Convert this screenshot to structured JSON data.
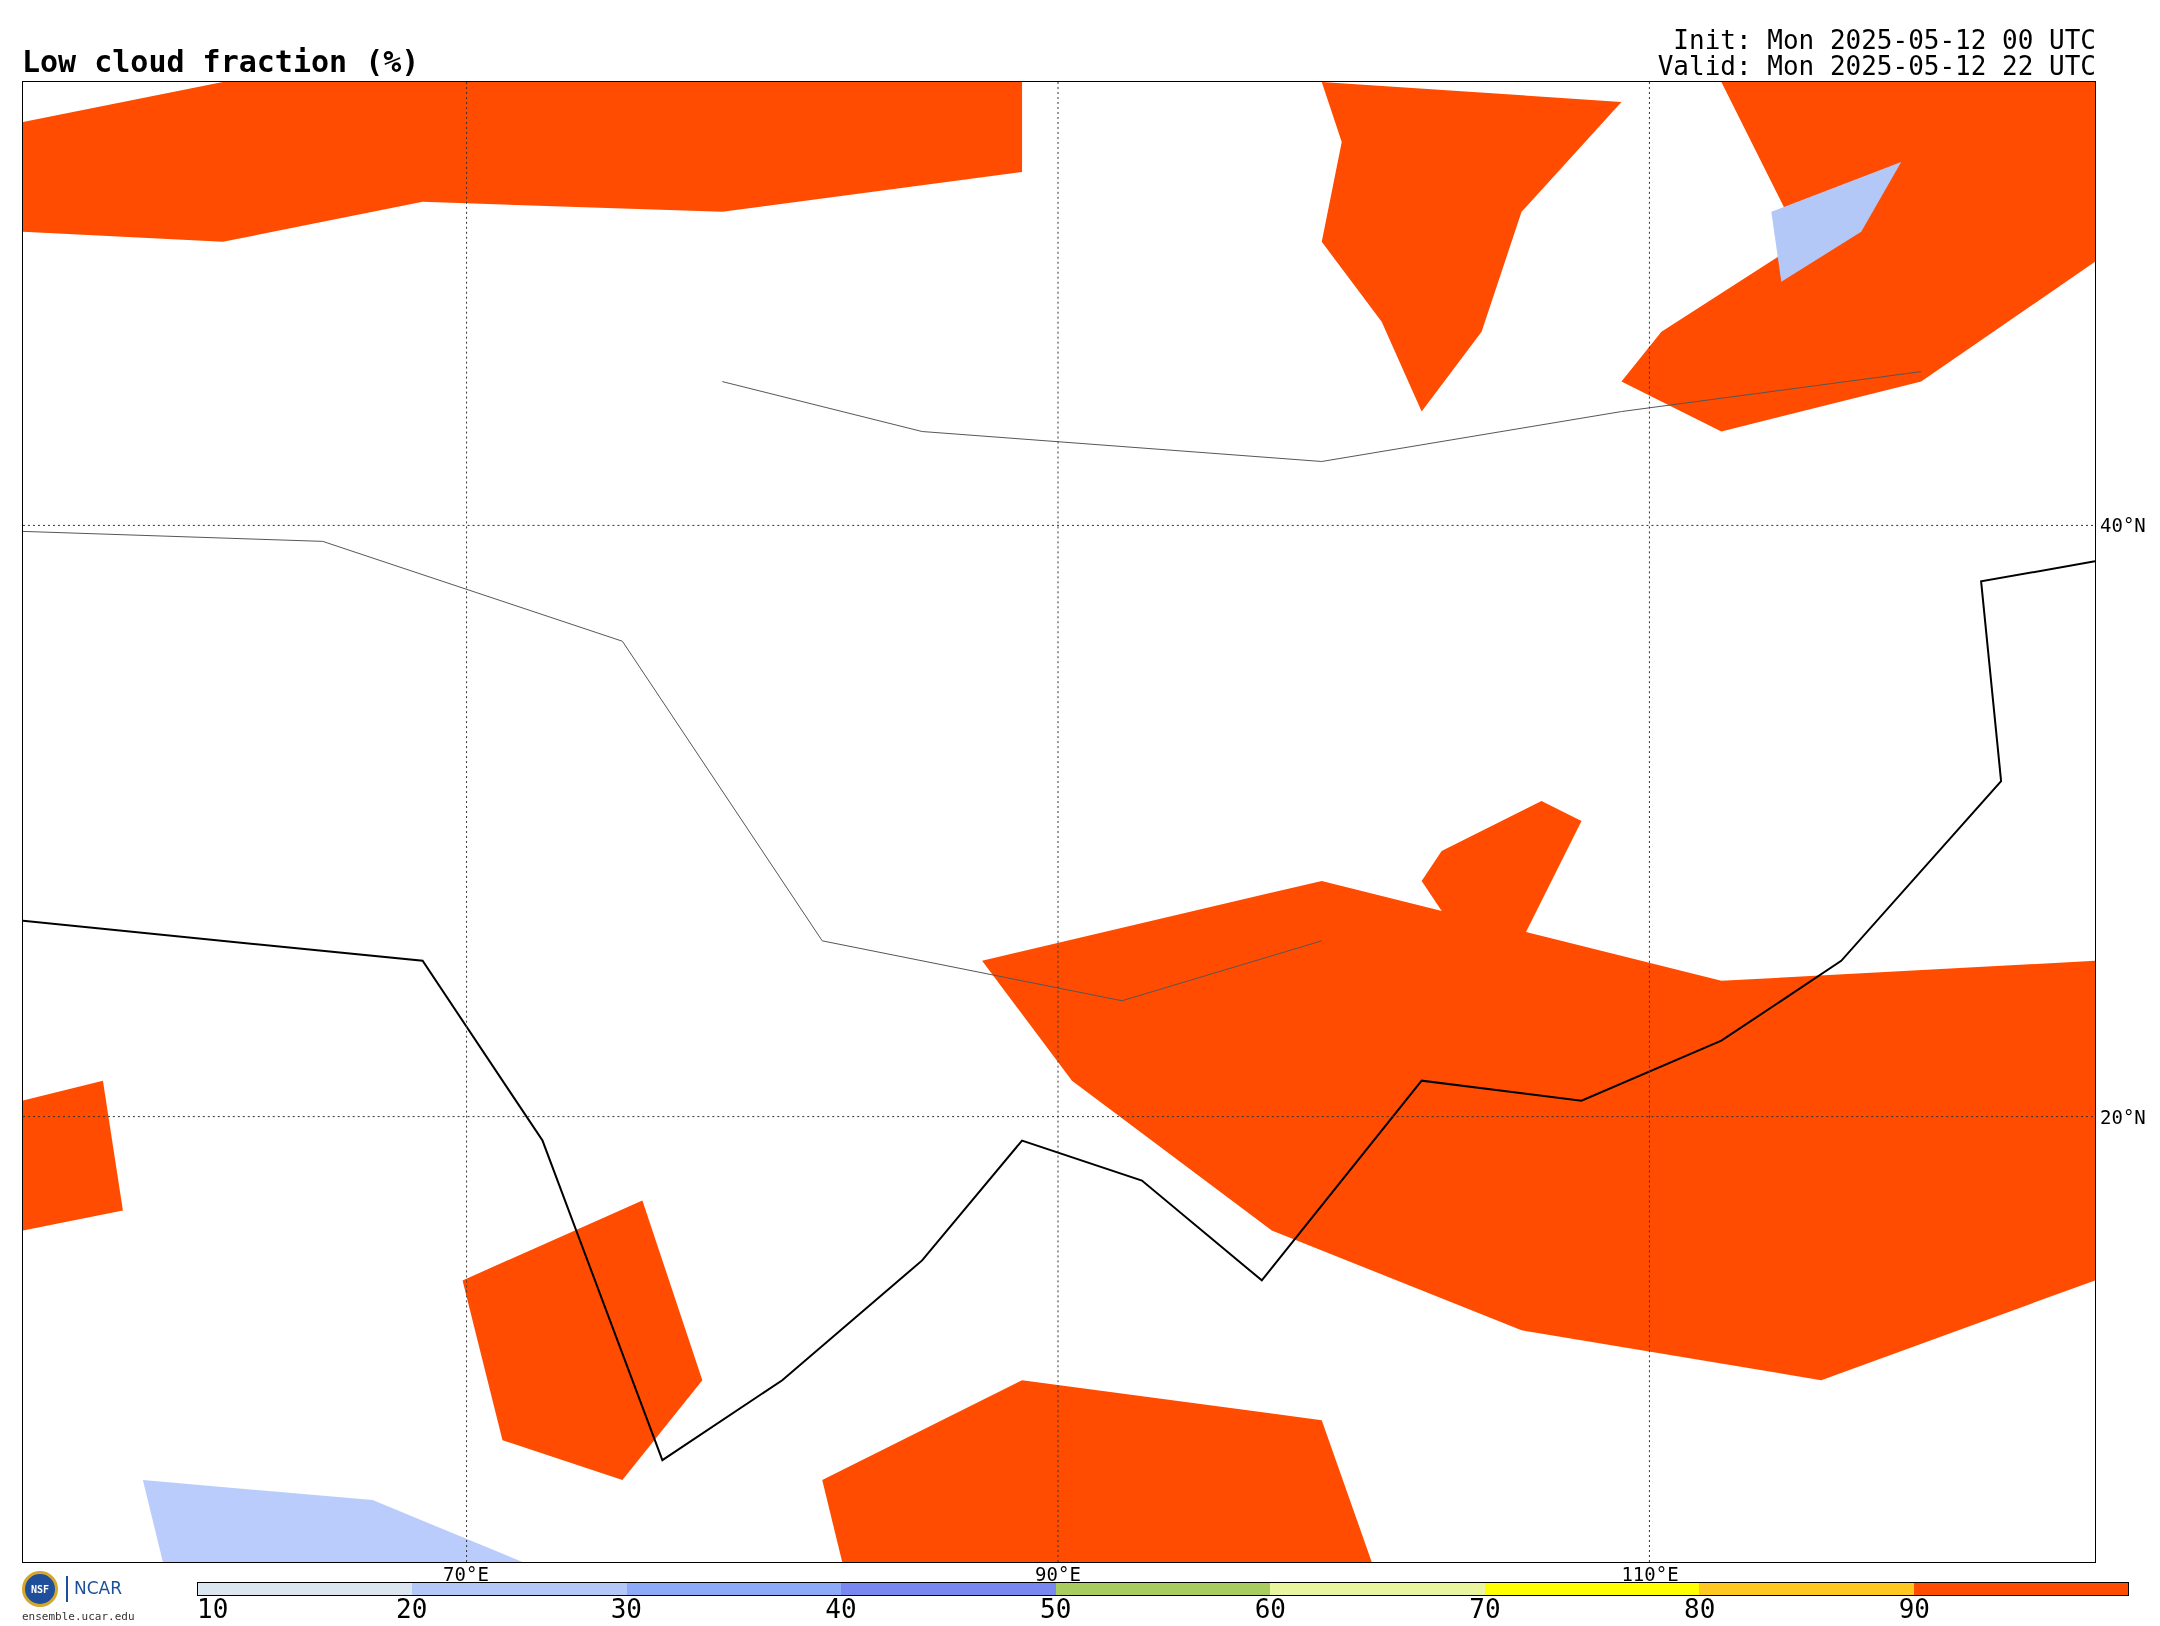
{
  "title": "Low cloud fraction (%)",
  "init": "Init: Mon 2025-05-12 00 UTC",
  "valid": "Valid: Mon 2025-05-12 22 UTC",
  "map": {
    "latitude_labels": [
      "40°N",
      "20°N"
    ],
    "longitude_labels": [
      "70°E",
      "90°E",
      "110°E"
    ]
  },
  "logo": {
    "seal": "NSF",
    "name": "NCAR",
    "url": "ensemble.ucar.edu"
  },
  "colorbar": {
    "bins": [
      {
        "label": "10",
        "color": "#dce6f0"
      },
      {
        "label": "20",
        "color": "#b4c8f8"
      },
      {
        "label": "30",
        "color": "#8caaf8"
      },
      {
        "label": "40",
        "color": "#7888f0"
      },
      {
        "label": "50",
        "color": "#a8cc60"
      },
      {
        "label": "60",
        "color": "#eaf5a0"
      },
      {
        "label": "70",
        "color": "#ffff00"
      },
      {
        "label": "80",
        "color": "#ffc820"
      },
      {
        "label": "90",
        "color": "#ff4c00"
      }
    ]
  }
}
